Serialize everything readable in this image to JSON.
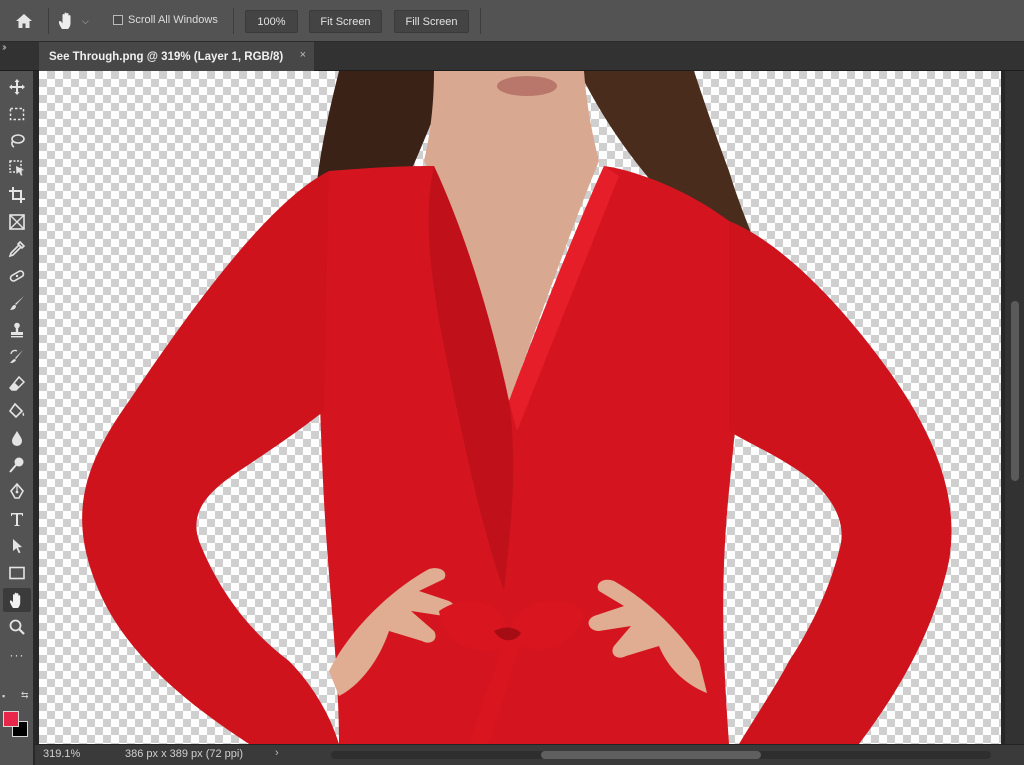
{
  "options_bar": {
    "scroll_all_windows_label": "Scroll All Windows",
    "zoom_100_label": "100%",
    "fit_screen_label": "Fit Screen",
    "fill_screen_label": "Fill Screen"
  },
  "tab": {
    "title": "See Through.png @ 319% (Layer 1, RGB/8)",
    "close": "×"
  },
  "toolbar": {
    "collapse": "››",
    "tools": [
      "move-icon",
      "marquee-icon",
      "lasso-icon",
      "object-select-icon",
      "crop-icon",
      "frame-icon",
      "eyedropper-icon",
      "healing-brush-icon",
      "brush-icon",
      "stamp-icon",
      "history-brush-icon",
      "eraser-icon",
      "paint-bucket-icon",
      "blur-icon",
      "dodge-icon",
      "pen-icon",
      "type-icon",
      "path-select-icon",
      "rectangle-icon",
      "hand-icon",
      "zoom-icon"
    ],
    "active_tool": "hand-icon",
    "foreground_color": "#e8274b",
    "background_color": "#000000"
  },
  "status_bar": {
    "zoom": "319.1%",
    "dimensions": "386 px x 389 px (72 ppi)",
    "arrow": "›"
  }
}
